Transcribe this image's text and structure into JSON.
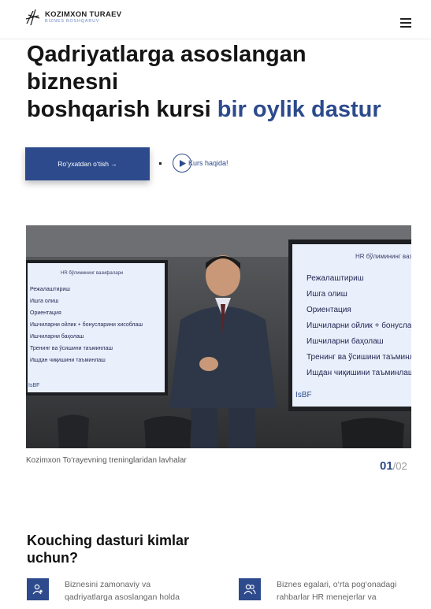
{
  "header": {
    "brand_name": "KOZIMXON TURAEV",
    "brand_sub": "BIZNES BOSHQARUV",
    "menu_icon": "hamburger-menu-icon"
  },
  "hero": {
    "title_line1": "Qadriyatlarga asoslangan",
    "title_line2": "biznesni",
    "title_line3": "boshqarish kursi",
    "title_accent": "bir oylik dastur",
    "cta_label": "Ro‘yxatdan o‘tish →",
    "about_label": "Kurs haqida!",
    "accent_color": "#2c4a8c"
  },
  "gallery": {
    "screen_title": "HR бўлимининг вазифалари",
    "screen_items": [
      "Режалаштириш",
      "Ишга олиш",
      "Ориентация",
      "Ишчиларни ойлик + бонусларини хисоблаш",
      "Ишчиларни баҳолаш",
      "Тренинг ва ўсишини таъминлаш",
      "Ишдан чиқишини таъминлаш"
    ],
    "screen_logo": "IsBF",
    "caption": "Kozimxon To‘rayevning treninglaridan lavhalar",
    "current": "01",
    "total": "/02"
  },
  "audience": {
    "title": "Kouching dasturi kimlar uchun?",
    "items": [
      {
        "icon": "user-star-icon",
        "text": "Biznesini zamonaviy va qadriyatlarga asoslangan holda"
      },
      {
        "icon": "users-icon",
        "text": "Biznes egalari, o‘rta pog‘onadagi rahbarlar HR menejerlar va"
      }
    ]
  }
}
